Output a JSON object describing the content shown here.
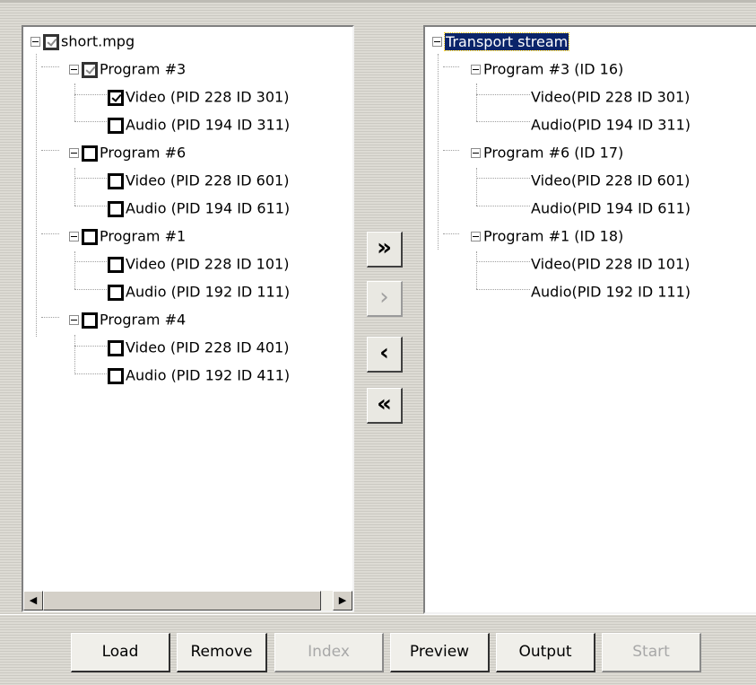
{
  "source_tree": {
    "root": {
      "label": "short.mpg",
      "checked": "partial"
    },
    "programs": [
      {
        "label": "Program #3",
        "checked": "partial",
        "streams": [
          {
            "label": "Video (PID 228 ID 301)",
            "checked": true
          },
          {
            "label": "Audio (PID 194 ID 311)",
            "checked": false
          }
        ]
      },
      {
        "label": "Program #6",
        "checked": false,
        "streams": [
          {
            "label": "Video (PID 228 ID 601)",
            "checked": false
          },
          {
            "label": "Audio (PID 194 ID 611)",
            "checked": false
          }
        ]
      },
      {
        "label": "Program #1",
        "checked": false,
        "streams": [
          {
            "label": "Video (PID 228 ID 101)",
            "checked": false
          },
          {
            "label": "Audio (PID 192 ID 111)",
            "checked": false
          }
        ]
      },
      {
        "label": "Program #4",
        "checked": false,
        "streams": [
          {
            "label": "Video (PID 228 ID 401)",
            "checked": false
          },
          {
            "label": "Audio (PID 192 ID 411)",
            "checked": false
          }
        ]
      }
    ]
  },
  "output_tree": {
    "root": {
      "label": "Transport stream",
      "selected": true
    },
    "programs": [
      {
        "label": "Program #3 (ID 16)",
        "streams": [
          {
            "label": "Video(PID 228 ID 301)"
          },
          {
            "label": "Audio(PID 194 ID 311)"
          }
        ]
      },
      {
        "label": "Program #6 (ID 17)",
        "streams": [
          {
            "label": "Video(PID 228 ID 601)"
          },
          {
            "label": "Audio(PID 194 ID 611)"
          }
        ]
      },
      {
        "label": "Program #1 (ID 18)",
        "streams": [
          {
            "label": "Video(PID 228 ID 101)"
          },
          {
            "label": "Audio(PID 192 ID 111)"
          }
        ]
      }
    ]
  },
  "move_buttons": {
    "add_all": {
      "glyph": "»",
      "enabled": true
    },
    "add": {
      "glyph": "›",
      "enabled": false
    },
    "remove": {
      "glyph": "‹",
      "enabled": true
    },
    "remove_all": {
      "glyph": "«",
      "enabled": true
    }
  },
  "scrollbar": {
    "left_arrow": "◀",
    "right_arrow": "▶"
  },
  "buttons": {
    "load": {
      "label": "Load",
      "enabled": true
    },
    "remove": {
      "label": "Remove",
      "enabled": true
    },
    "index": {
      "label": "Index",
      "enabled": false
    },
    "preview": {
      "label": "Preview",
      "enabled": true
    },
    "output": {
      "label": "Output",
      "enabled": true
    },
    "start": {
      "label": "Start",
      "enabled": false
    }
  },
  "colors": {
    "selection": "#0a246a",
    "disabled_text": "#a8a8a8"
  }
}
